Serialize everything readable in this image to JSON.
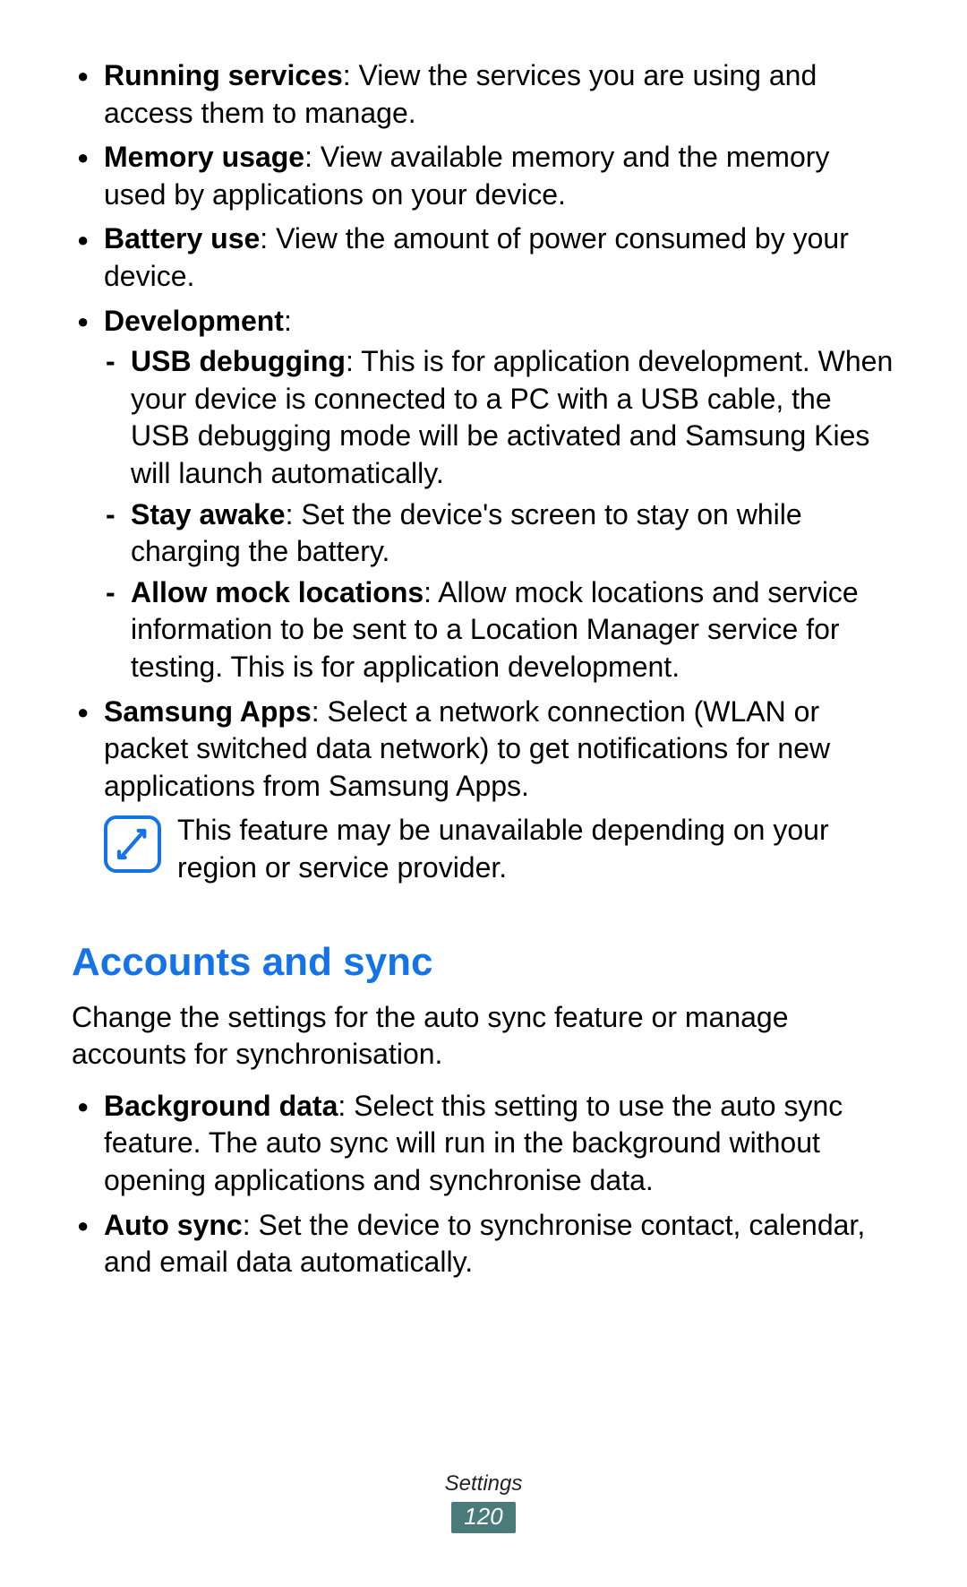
{
  "bullets": {
    "running_services": {
      "label": "Running services",
      "text": ": View the services you are using and access them to manage."
    },
    "memory_usage": {
      "label": "Memory usage",
      "text": ": View available memory and the memory used by applications on your device."
    },
    "battery_use": {
      "label": "Battery use",
      "text": ": View the amount of power consumed by your device."
    },
    "development": {
      "label": "Development",
      "colon": ":",
      "usb_debugging": {
        "label": "USB debugging",
        "text": ": This is for application development. When your device is connected to a PC with a USB cable, the USB debugging mode will be activated and Samsung Kies will launch automatically."
      },
      "stay_awake": {
        "label": "Stay awake",
        "text": ": Set the device's screen to stay on while charging the battery."
      },
      "allow_mock": {
        "label": "Allow mock locations",
        "text": ": Allow mock locations and service information to be sent to a Location Manager service for testing. This is for application development."
      }
    },
    "samsung_apps": {
      "label": "Samsung Apps",
      "text": ": Select a network connection (WLAN or packet switched data network) to get notifications for new applications from Samsung Apps."
    },
    "note": "This feature may be unavailable depending on your region or service provider."
  },
  "section2": {
    "heading": "Accounts and sync",
    "intro": "Change the settings for the auto sync feature or manage accounts for synchronisation.",
    "background_data": {
      "label": "Background data",
      "text": ": Select this setting to use the auto sync feature. The auto sync will run in the background without opening applications and synchronise data."
    },
    "auto_sync": {
      "label": "Auto sync",
      "text": ": Set the device to synchronise contact, calendar, and email data automatically."
    }
  },
  "footer": {
    "section": "Settings",
    "page": "120"
  }
}
